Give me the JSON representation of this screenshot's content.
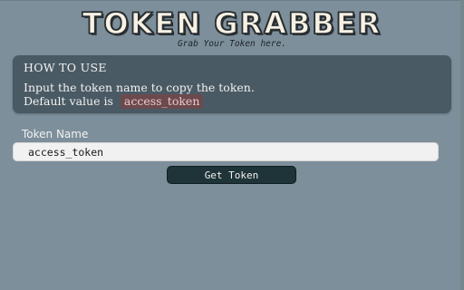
{
  "header": {
    "title": "TOKEN GRABBER",
    "subtitle": "Grab Your Token here."
  },
  "instructions": {
    "heading": "HOW TO USE",
    "line1": "Input the token name to copy the token.",
    "line2_prefix": "Default value is",
    "default_value": "access_token"
  },
  "form": {
    "label": "Token Name",
    "input_value": "access_token",
    "button_label": "Get Token"
  },
  "colors": {
    "background": "#7d8f9b",
    "card": "#4a5a64",
    "button": "#1f3438",
    "badge": "#6b4a4e"
  }
}
